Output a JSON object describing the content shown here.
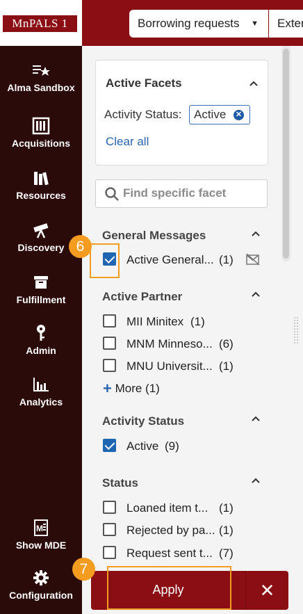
{
  "header": {
    "logo_text": "MnPALS 1",
    "search_type": "Borrowing requests",
    "search_scope": "Exter"
  },
  "leftnav": {
    "items": [
      {
        "label": "Alma Sandbox",
        "icon": "sandbox-icon"
      },
      {
        "label": "Acquisitions",
        "icon": "abacus-icon"
      },
      {
        "label": "Resources",
        "icon": "books-icon"
      },
      {
        "label": "Discovery",
        "icon": "telescope-icon"
      },
      {
        "label": "Fulfillment",
        "icon": "box-icon"
      },
      {
        "label": "Admin",
        "icon": "key-icon"
      },
      {
        "label": "Analytics",
        "icon": "bar-chart-icon"
      },
      {
        "label": "Show MDE",
        "icon": "metadata-editor-icon"
      },
      {
        "label": "Configuration",
        "icon": "gear-icon"
      }
    ]
  },
  "active_facets": {
    "title": "Active Facets",
    "status_label": "Activity Status:",
    "chip_value": "Active",
    "clear_all": "Clear all"
  },
  "find_facet": {
    "placeholder": "Find specific facet"
  },
  "sections": {
    "general_messages": {
      "title": "General Messages",
      "items": [
        {
          "label": "Active General...",
          "count": "(1)",
          "checked": true
        }
      ]
    },
    "active_partner": {
      "title": "Active Partner",
      "items": [
        {
          "label": "MII Minitex",
          "count": "(1)",
          "checked": false
        },
        {
          "label": "MNM Minneso...",
          "count": "(6)",
          "checked": false
        },
        {
          "label": "MNU Universit...",
          "count": "(1)",
          "checked": false
        }
      ],
      "more": "More (1)"
    },
    "activity_status": {
      "title": "Activity Status",
      "items": [
        {
          "label": "Active",
          "count": "(9)",
          "checked": true
        }
      ]
    },
    "status": {
      "title": "Status",
      "items": [
        {
          "label": "Loaned item t...",
          "count": "(1)",
          "checked": false
        },
        {
          "label": "Rejected by pa...",
          "count": "(1)",
          "checked": false
        },
        {
          "label": "Request sent t...",
          "count": "(7)",
          "checked": false
        }
      ]
    }
  },
  "annotations": {
    "step6": "6",
    "step7": "7"
  },
  "footer": {
    "apply_label": "Apply",
    "cancel_label": "✕"
  },
  "colors": {
    "brand": "#8b0e14",
    "nav_bg": "#2b0a0a",
    "accent_blue": "#1f66b2",
    "highlight": "#f39c1f"
  }
}
